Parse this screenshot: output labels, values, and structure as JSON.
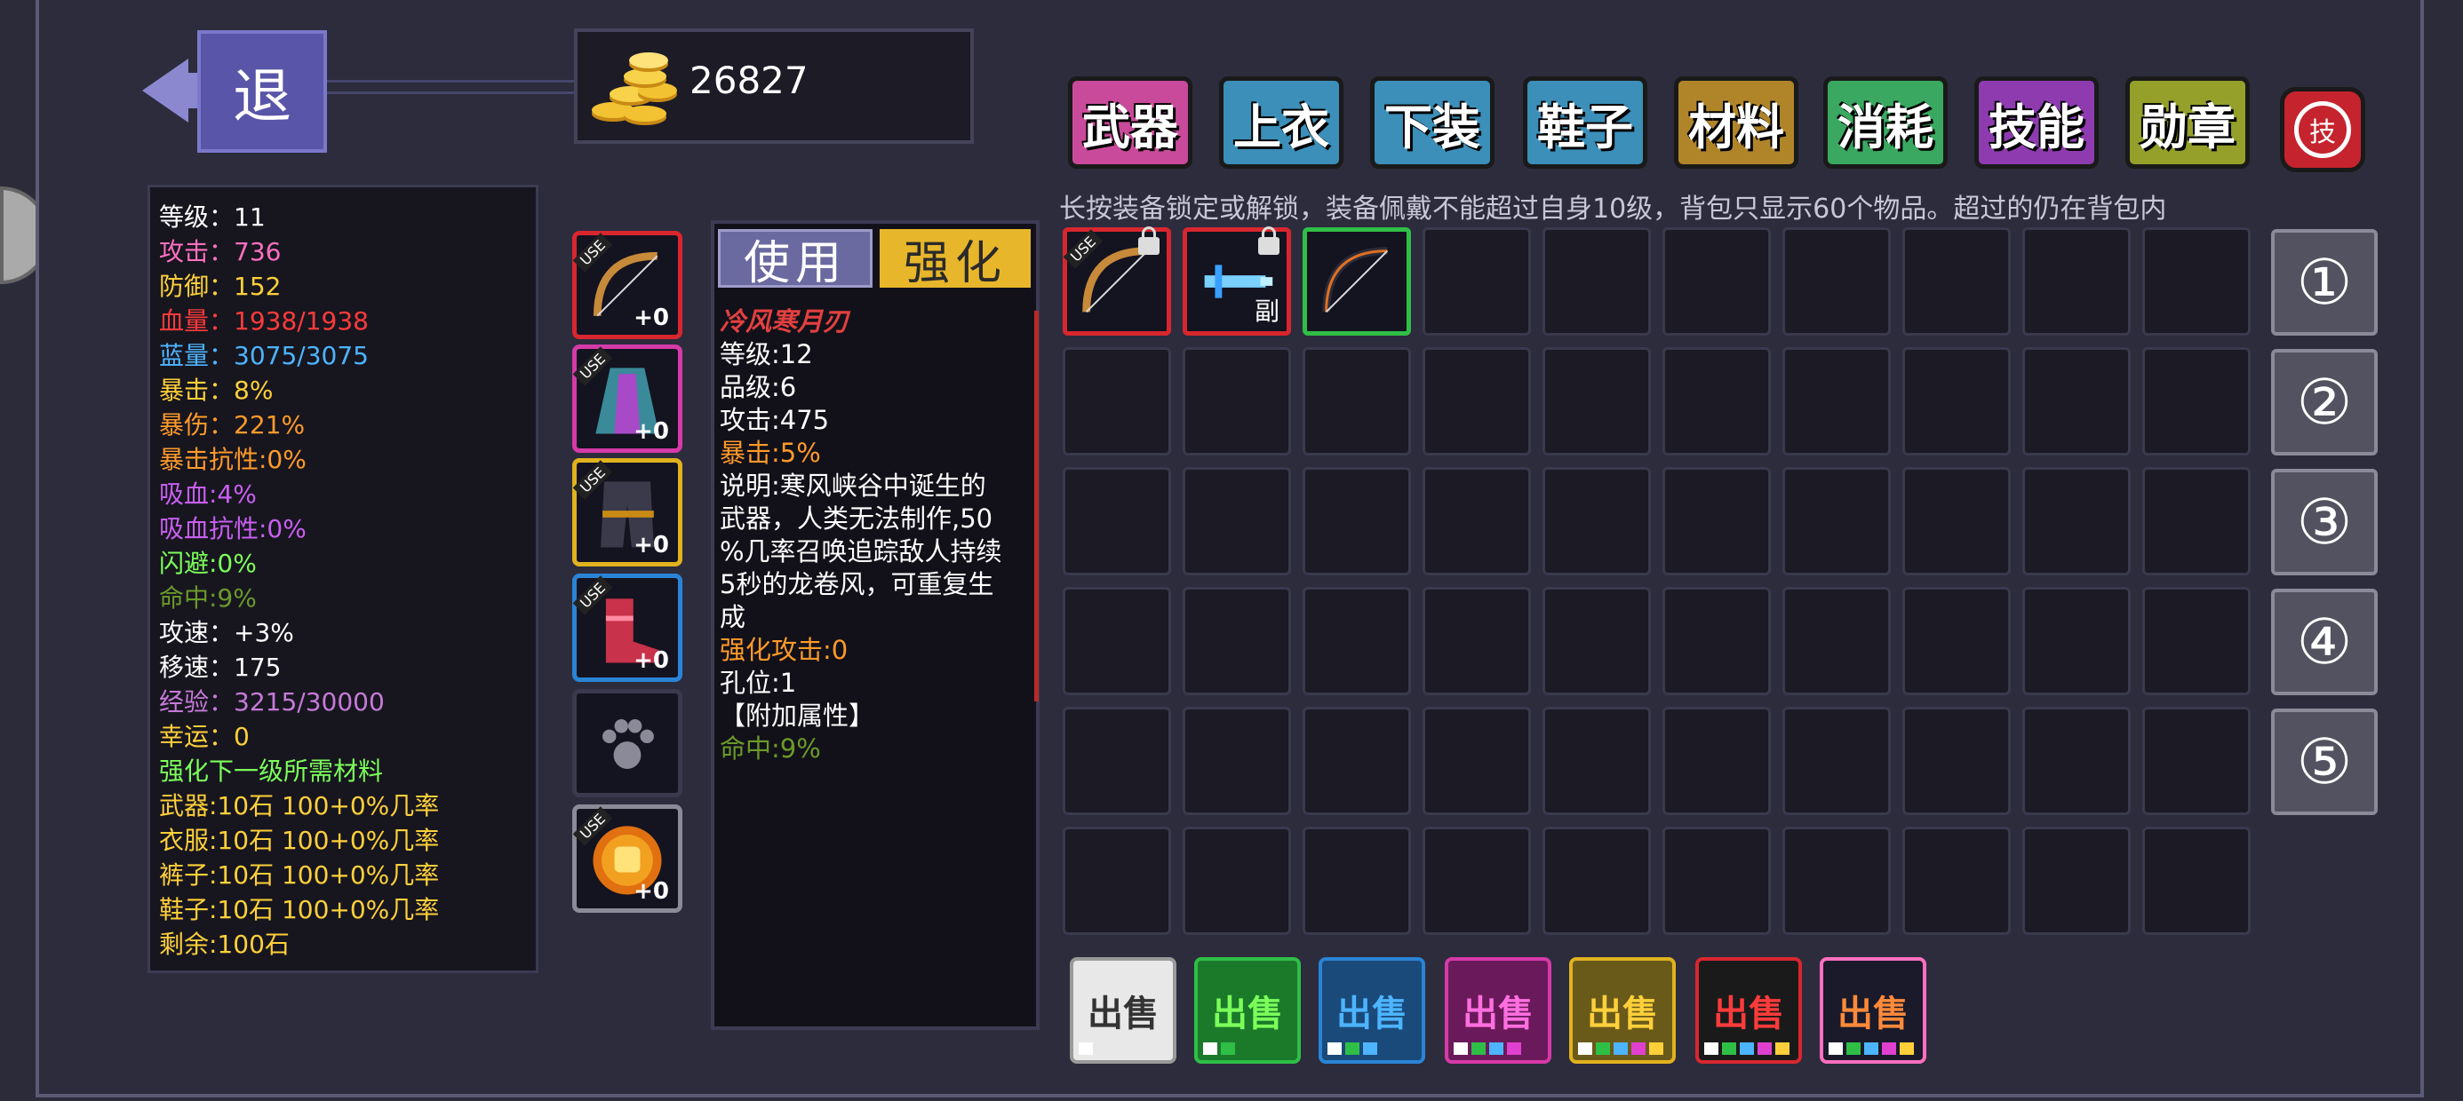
{
  "back": {
    "label": "退"
  },
  "gold": {
    "value": "26827"
  },
  "stats": [
    {
      "text": "等级：11",
      "color": "#ffffff"
    },
    {
      "text": "攻击：736",
      "color": "#ff6fc0"
    },
    {
      "text": "防御：152",
      "color": "#ffd03a"
    },
    {
      "text": "血量：1938/1938",
      "color": "#ff3b3b"
    },
    {
      "text": "蓝量：3075/3075",
      "color": "#4db4ff"
    },
    {
      "text": "暴击：8%",
      "color": "#ffd03a"
    },
    {
      "text": "暴伤：221%",
      "color": "#ff9a2a"
    },
    {
      "text": "暴击抗性:0%",
      "color": "#ff9a2a"
    },
    {
      "text": "吸血:4%",
      "color": "#c85ff0"
    },
    {
      "text": "吸血抗性:0%",
      "color": "#c85ff0"
    },
    {
      "text": "闪避:0%",
      "color": "#7cff5a"
    },
    {
      "text": "命中:9%",
      "color": "#6b9a2a"
    },
    {
      "text": "攻速：+3%",
      "color": "#ffffff"
    },
    {
      "text": "移速：175",
      "color": "#ffffff"
    },
    {
      "text": "经验：3215/30000",
      "color": "#c67ad8"
    },
    {
      "text": "幸运：0",
      "color": "#ffd03a"
    },
    {
      "text": "强化下一级所需材料",
      "color": "#7cff5a"
    },
    {
      "text": "武器:10石 100+0%几率",
      "color": "#ffd03a"
    },
    {
      "text": "衣服:10石 100+0%几率",
      "color": "#ffd03a"
    },
    {
      "text": "裤子:10石 100+0%几率",
      "color": "#ffd03a"
    },
    {
      "text": "鞋子:10石 100+0%几率",
      "color": "#ffd03a"
    },
    {
      "text": "剩余:100石",
      "color": "#ffd03a"
    }
  ],
  "equipped": {
    "use_label": "USE",
    "slots": [
      {
        "name": "weapon",
        "icon": "bow-icon",
        "plus": "+0",
        "border": "#d8262e"
      },
      {
        "name": "armor",
        "icon": "robe-icon",
        "plus": "+0",
        "border": "#d63aa8"
      },
      {
        "name": "pants",
        "icon": "pants-icon",
        "plus": "+0",
        "border": "#e0b21e"
      },
      {
        "name": "shoes",
        "icon": "boots-icon",
        "plus": "+0",
        "border": "#2a84d6"
      },
      {
        "name": "pet",
        "icon": "paw-icon",
        "plus": "",
        "border": "#3a394d"
      },
      {
        "name": "medal",
        "icon": "fist-medal-icon",
        "plus": "+0",
        "border": "#8a8a98"
      }
    ]
  },
  "detail": {
    "tab_use": "使用",
    "tab_strengthen": "强化",
    "lines": [
      {
        "text": "冷风寒月刃",
        "color": "#e24040",
        "bold": true
      },
      {
        "text": "等级:12",
        "color": "#ffffff"
      },
      {
        "text": "品级:6",
        "color": "#ffffff"
      },
      {
        "text": "攻击:475",
        "color": "#ffffff"
      },
      {
        "text": "暴击:5%",
        "color": "#ff9a2a"
      },
      {
        "text": "说明:寒风峡谷中诞生的",
        "color": "#ffffff"
      },
      {
        "text": "武器，人类无法制作,50",
        "color": "#ffffff"
      },
      {
        "text": "%几率召唤追踪敌人持续",
        "color": "#ffffff"
      },
      {
        "text": "5秒的龙卷风，可重复生",
        "color": "#ffffff"
      },
      {
        "text": "成",
        "color": "#ffffff"
      },
      {
        "text": "强化攻击:0",
        "color": "#ff9a2a"
      },
      {
        "text": "孔位:1",
        "color": "#ffffff"
      },
      {
        "text": "【附加属性】",
        "color": "#ffffff"
      },
      {
        "text": "命中:9%",
        "color": "#6b9a2a"
      }
    ]
  },
  "categories": [
    {
      "label": "武器",
      "color": "#c94a9a"
    },
    {
      "label": "上衣",
      "color": "#3b8fb8"
    },
    {
      "label": "下装",
      "color": "#3b8fb8"
    },
    {
      "label": "鞋子",
      "color": "#3b8fb8"
    },
    {
      "label": "材料",
      "color": "#b0852a"
    },
    {
      "label": "消耗",
      "color": "#3aa861"
    },
    {
      "label": "技能",
      "color": "#8e3bb0"
    },
    {
      "label": "勋章",
      "color": "#94a02a"
    }
  ],
  "refresh_label": "技",
  "hint": "长按装备锁定或解锁，装备佩戴不能超过自身10级，背包只显示60个物品。超过的仍在背包内",
  "inventory": {
    "items": [
      {
        "icon": "bow-icon",
        "locked": true,
        "use": "USE",
        "border": "#d8262e"
      },
      {
        "icon": "crystal-sword-icon",
        "locked": true,
        "sub": "副",
        "border": "#d8262e"
      },
      {
        "icon": "dark-bow-icon",
        "locked": false,
        "border": "#2fbf47"
      }
    ]
  },
  "loadouts": [
    "①",
    "②",
    "③",
    "④",
    "⑤"
  ],
  "sell_buttons": [
    {
      "label": "出售",
      "bg": "#e8e8e8",
      "fg": "#333333",
      "border": "#9a9a9a",
      "dots": [
        "#ffffff"
      ]
    },
    {
      "label": "出售",
      "bg": "#1a7a2a",
      "fg": "#7cff5a",
      "border": "#2fbf47",
      "dots": [
        "#ffffff",
        "#2fbf47"
      ]
    },
    {
      "label": "出售",
      "bg": "#1a4a7a",
      "fg": "#4db4ff",
      "border": "#2a84d6",
      "dots": [
        "#ffffff",
        "#2fbf47",
        "#4db4ff"
      ]
    },
    {
      "label": "出售",
      "bg": "#6a1a5a",
      "fg": "#ff6fe0",
      "border": "#d63aa8",
      "dots": [
        "#ffffff",
        "#2fbf47",
        "#4db4ff",
        "#e040d0"
      ]
    },
    {
      "label": "出售",
      "bg": "#6a5a1a",
      "fg": "#ffd03a",
      "border": "#e0b21e",
      "dots": [
        "#ffffff",
        "#2fbf47",
        "#4db4ff",
        "#e040d0",
        "#ffd03a"
      ]
    },
    {
      "label": "出售",
      "bg": "#1a1a1a",
      "fg": "#ff3b3b",
      "border": "#d8262e",
      "dots": [
        "#ffffff",
        "#2fbf47",
        "#4db4ff",
        "#e040d0",
        "#ffd03a"
      ]
    },
    {
      "label": "出售",
      "bg": "#1a1a2a",
      "fg": "#ff8a3a",
      "border": "#ff6fc0",
      "dots": [
        "#ffffff",
        "#2fbf47",
        "#4db4ff",
        "#e040d0",
        "#ffd03a"
      ]
    }
  ]
}
